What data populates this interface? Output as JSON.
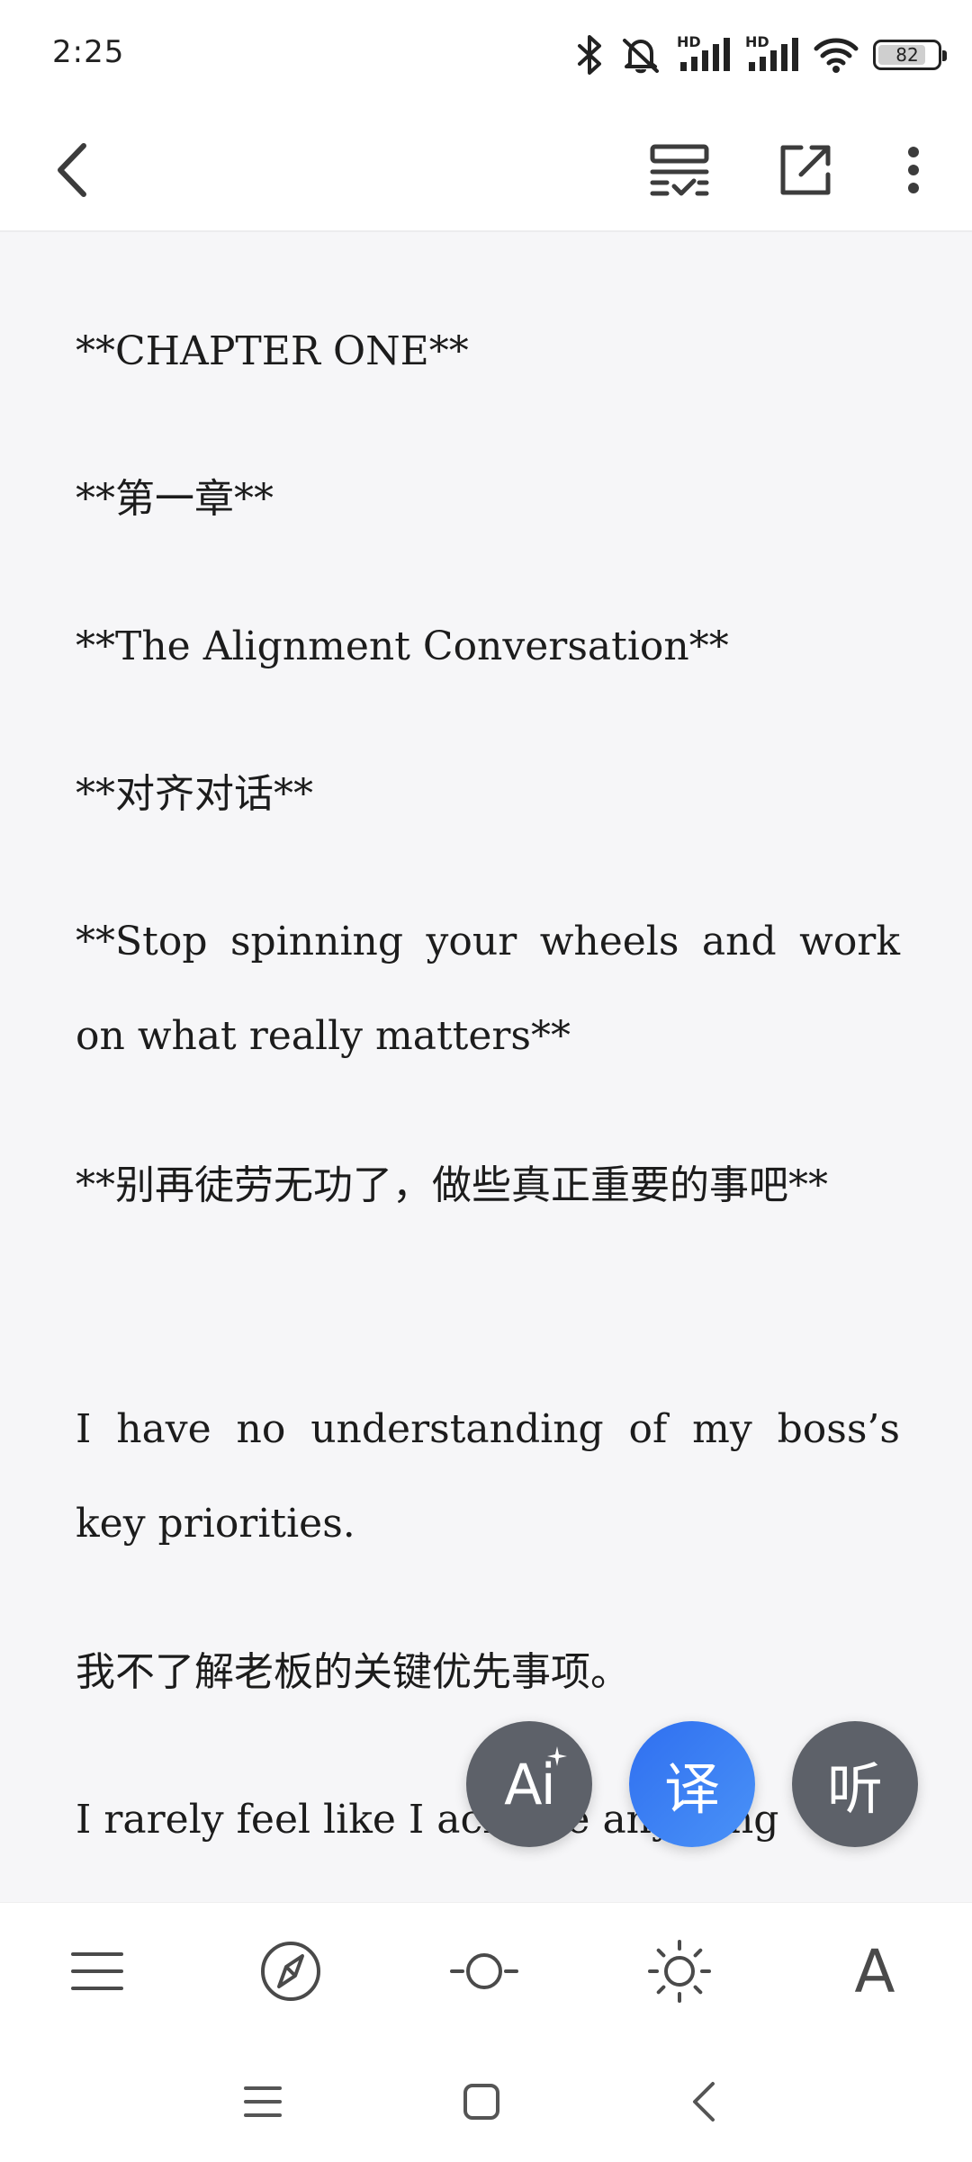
{
  "status_bar": {
    "time": "2:25",
    "network_label_1": "HD",
    "network_label_2": "HD",
    "battery_percent": 82,
    "battery_text": "82"
  },
  "toolbar": {
    "icons": [
      "back-icon",
      "reading-mode-icon",
      "share-icon",
      "more-icon"
    ]
  },
  "content": {
    "paragraphs": [
      "**CHAPTER ONE**",
      "**第一章**",
      "**The Alignment Conversation**",
      "**对齐对话**",
      "**Stop spinning your wheels and work on what really matters**",
      "**别再徒劳无功了，做些真正重要的事吧**",
      "I have no understanding of my boss’s key priorities.",
      "我不了解老板的关键优先事项。",
      "I rarely feel like I achieve anything"
    ]
  },
  "fabs": {
    "ai_label": "Ai",
    "translate_label": "译",
    "listen_label": "听"
  },
  "reader_bar": {
    "icons": [
      "menu-icon",
      "compass-icon",
      "progress-icon",
      "brightness-icon",
      "font-icon"
    ],
    "font_label": "A"
  },
  "nav_bar": {
    "icons": [
      "recent-apps-icon",
      "home-icon",
      "back-nav-icon"
    ]
  },
  "colors": {
    "content_bg": "#f6f6f8",
    "fab_gray": "#5d6169",
    "fab_blue": "#3a7ff4"
  }
}
